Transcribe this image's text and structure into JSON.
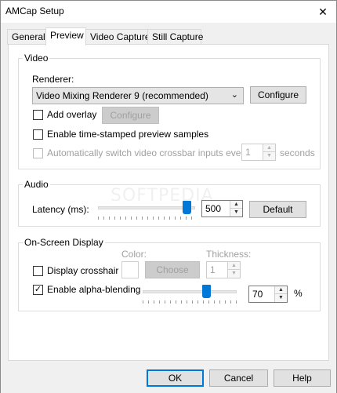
{
  "window": {
    "title": "AMCap Setup",
    "close_glyph": "✕"
  },
  "tabs": [
    "General",
    "Preview",
    "Video Capture",
    "Still Capture"
  ],
  "video": {
    "group_title": "Video",
    "renderer_label": "Renderer:",
    "renderer_value": "Video Mixing Renderer 9 (recommended)",
    "configure_label": "Configure",
    "add_overlay_label": "Add overlay",
    "add_overlay_checked": false,
    "overlay_configure_label": "Configure",
    "timestamp_label": "Enable time-stamped preview samples",
    "timestamp_checked": false,
    "auto_switch_label": "Automatically switch video crossbar inputs every:",
    "auto_switch_checked": false,
    "seconds_value": "1",
    "seconds_unit": "seconds"
  },
  "audio": {
    "group_title": "Audio",
    "latency_label": "Latency (ms):",
    "latency_value": "500",
    "latency_slider_fraction": 0.96,
    "default_label": "Default"
  },
  "osd": {
    "group_title": "On-Screen Display",
    "color_label": "Color:",
    "thickness_label": "Thickness:",
    "crosshair_label": "Display crosshair",
    "crosshair_checked": false,
    "choose_label": "Choose",
    "thickness_value": "1",
    "alpha_label": "Enable alpha-blending",
    "alpha_checked": true,
    "alpha_check_glyph": "✓",
    "alpha_value": "70",
    "alpha_unit": "%",
    "alpha_slider_fraction": 0.7
  },
  "footer": {
    "ok_label": "OK",
    "cancel_label": "Cancel",
    "help_label": "Help"
  },
  "watermark_text": "SOFTPEDIA",
  "colors": {
    "accent": "#0078d7",
    "disabled_text": "#a0a0a0",
    "dialog_bg": "#f0f0f0"
  },
  "icons": {
    "close": "close-icon",
    "dropdown": "chevron-down-icon",
    "spin_up": "spin-up-icon",
    "spin_down": "spin-down-icon"
  }
}
